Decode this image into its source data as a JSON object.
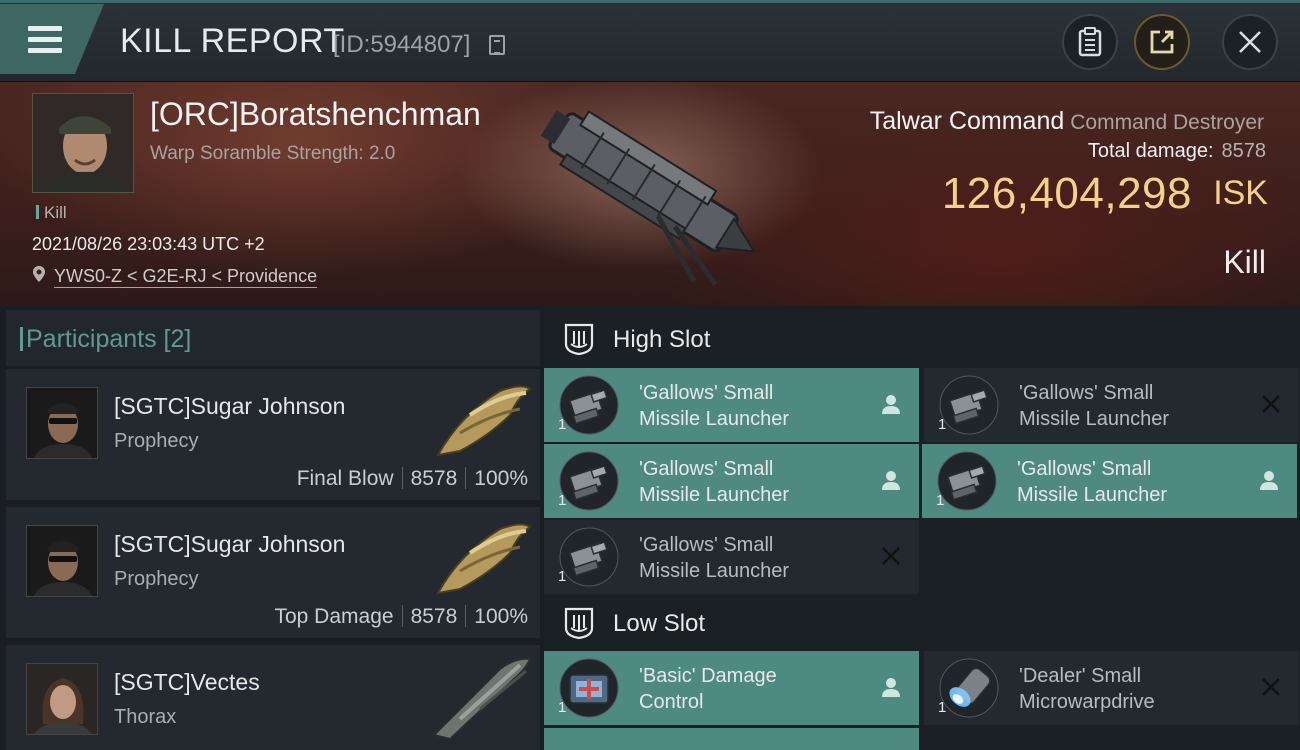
{
  "header": {
    "title": "KILL REPORT",
    "kill_id": "[ID:5944807]"
  },
  "victim": {
    "name": "[ORC]Boratshenchman",
    "warp_scramble": "Warp Soramble Strength: 2.0",
    "tag": "Kill",
    "time": "2021/08/26 23:03:43 UTC +2",
    "location": "YWS0-Z < G2E-RJ < Providence",
    "ship_name": "Talwar Command",
    "ship_class": "Command Destroyer",
    "total_damage_label": "Total damage:",
    "total_damage": "8578",
    "isk_value": "126,404,298",
    "isk_unit": "ISK",
    "status": "Kill"
  },
  "participants": {
    "label": "Participants [2]",
    "items": [
      {
        "name": "[SGTC]Sugar Johnson",
        "ship": "Prophecy",
        "role": "Final Blow",
        "damage": "8578",
        "percent": "100%"
      },
      {
        "name": "[SGTC]Sugar Johnson",
        "ship": "Prophecy",
        "role": "Top Damage",
        "damage": "8578",
        "percent": "100%"
      },
      {
        "name": "[SGTC]Vectes",
        "ship": "Thorax"
      }
    ]
  },
  "slots": {
    "high": {
      "label": "High Slot",
      "modules": [
        {
          "name1": "'Gallows' Small",
          "name2": "Missile Launcher",
          "qty": "1",
          "state": "dropped"
        },
        {
          "name1": "'Gallows' Small",
          "name2": "Missile Launcher",
          "qty": "1",
          "state": "destroyed"
        },
        {
          "name1": "'Gallows' Small",
          "name2": "Missile Launcher",
          "qty": "1",
          "state": "dropped"
        },
        {
          "name1": "'Gallows' Small",
          "name2": "Missile Launcher",
          "qty": "1",
          "state": "dropped"
        },
        {
          "name1": "'Gallows' Small",
          "name2": "Missile Launcher",
          "qty": "1",
          "state": "destroyed"
        }
      ]
    },
    "low": {
      "label": "Low Slot",
      "modules": [
        {
          "name1": "'Basic' Damage",
          "name2": "Control",
          "qty": "1",
          "state": "dropped"
        },
        {
          "name1": "'Dealer' Small",
          "name2": "Microwarpdrive",
          "qty": "1",
          "state": "destroyed"
        }
      ]
    }
  },
  "colors": {
    "accent": "#4f8a82",
    "isk": "#f4d28a",
    "participants_label": "#5d9a95"
  }
}
